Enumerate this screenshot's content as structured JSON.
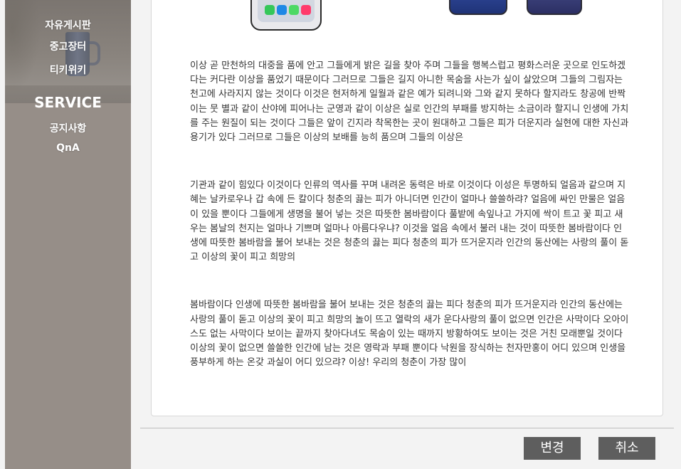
{
  "sidebar": {
    "top_links": [
      "자유게시판",
      "중고장터",
      "티키위키"
    ],
    "section_title": "SERVICE",
    "service_links": [
      "공지사항",
      "QnA"
    ]
  },
  "content": {
    "paragraphs": [
      "이상 곧 만천하의 대중을 품에 안고 그들에게 밝은 길을 찾아 주며 그들을 행복스럽고 평화스러운 곳으로 인도하겠다는 커다란 이상을 품었기 때문이다 그러므로 그들은 길지 아니한 목숨을 사는가 싶이 살았으며 그들의 그림자는 천고에 사라지지 않는 것이다 이것은 현저하게 일월과 같은 예가 되려니와 그와 같지 못하다 할지라도 창공에 반짝이는 뭇 별과 같이 산야에 피어나는 군영과 같이 이상은 실로 인간의 부패를 방지하는 소금이라 할지니 인생에 가치를 주는 원질이 되는 것이다 그들은 앞이 긴지라 착목한는 곳이 원대하고 그들은 피가 더운지라 실현에 대한 자신과 용기가 있다 그러므로 그들은 이상의 보배를 능히 품으며 그들의 이상은",
      "기관과 같이 힘있다 이것이다 인류의 역사를 꾸며 내려온 동력은 바로 이것이다 이성은 투명하되 얼음과 같으며 지혜는 날카로우나 갑 속에 든 칼이다 청춘의 끓는 피가 아니더면 인간이 얼마나 쓸쓸하랴? 얼음에 싸인 만물은 얼음이 있을 뿐이다 그들에게 생명을 불어 넣는 것은 따뜻한 봄바람이다 풀밭에 속잎나고 가지에 싹이 트고 꽃 피고 새 우는 봄날의 천지는 얼마나 기쁘며 얼마나 아름다우냐? 이것을 얼음 속에서 불러 내는 것이 따뜻한 봄바람이다 인생에 따뜻한 봄바람을 불어 보내는 것은 청춘의 끓는 피다 청춘의 피가 뜨거운지라 인간의 동산에는 사랑의 풀이 돋고 이상의 꽃이 피고 희망의",
      "봄바람이다 인생에 따뜻한 봄바람을 불어 보내는 것은 청춘의 끓는 피다 청춘의 피가 뜨거운지라 인간의 동산에는 사랑의 풀이 돋고 이상의 꽃이 피고 희망의 놀이 뜨고 열락의 새가 운다사랑의 풀이 없으면 인간은 사막이다 오아이스도 없는 사막이다 보이는 끝까지 찾아다녀도 목숨이 있는 때까지 방황하여도 보이는 것은 거친 모래뿐일 것이다 이상의 꽃이 없으면 쓸쓸한 인간에 남는 것은 영락과 부패 뿐이다 낙원을 장식하는 천자만홍이 어디 있으며 인생을 풍부하게 하는 온갖 과실이 어디 있으랴? 이상! 우리의 청춘이 가장 많이"
    ]
  },
  "buttons": {
    "change_label": "변경",
    "cancel_label": "취소"
  },
  "colors": {
    "sidebar_bg": "#968e88",
    "button_bg": "#5e5e5e",
    "card_bg": "#ffffff",
    "page_bg": "#f3f3f3"
  },
  "icons": [
    "phone-app-call-icon",
    "phone-app-safari-icon",
    "phone-app-messages-icon",
    "phone-app-music-icon"
  ]
}
